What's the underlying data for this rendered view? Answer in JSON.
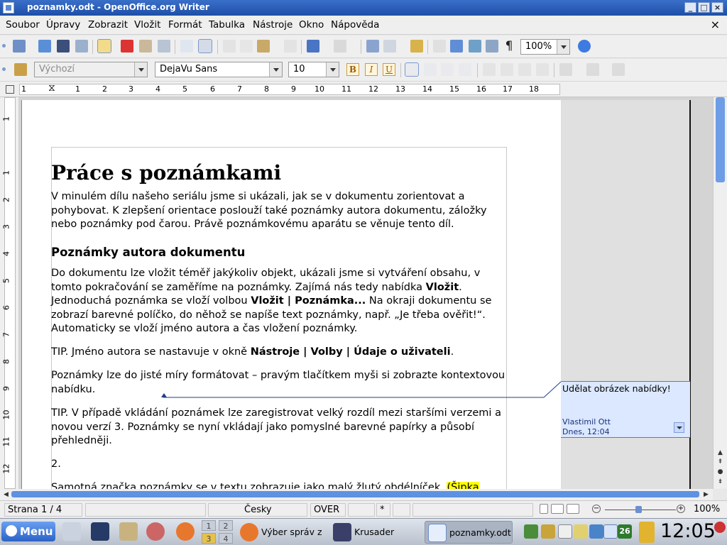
{
  "window": {
    "title": "poznamky.odt - OpenOffice.org Writer",
    "min": "_",
    "max": "□",
    "close": "×"
  },
  "menu": {
    "items": [
      "Soubor",
      "Úpravy",
      "Zobrazit",
      "Vložit",
      "Formát",
      "Tabulka",
      "Nástroje",
      "Okno",
      "Nápověda"
    ],
    "close": "×"
  },
  "toolbar": {
    "zoom": "100%",
    "style": "Výchozí",
    "font": "DejaVu Sans",
    "size": "10",
    "bold": "B",
    "italic": "I",
    "underline": "U"
  },
  "ruler": {
    "numbers": [
      "1",
      "1",
      "2",
      "3",
      "4",
      "5",
      "6",
      "7",
      "8",
      "9",
      "10",
      "11",
      "12",
      "13",
      "14",
      "15",
      "16",
      "17",
      "18"
    ],
    "vnumbers": [
      "1",
      "1",
      "2",
      "3",
      "4",
      "5",
      "6",
      "7",
      "8",
      "9",
      "10",
      "11",
      "12"
    ]
  },
  "document": {
    "heading1": "Práce s poznámkami",
    "p1": "V minulém dílu našeho seriálu jsme si ukázali, jak se v dokumentu zorientovat a pohybovat. K zlepšení orientace poslouží také poznámky autora dokumentu, záložky nebo poznámky pod čarou. Právě poznámkovému aparátu se věnuje tento díl.",
    "heading2": "Poznámky autora dokumentu",
    "p2a": "Do dokumentu lze vložit téměř jakýkoliv objekt, ukázali jsme si vytváření obsahu, v tomto pokračování se zaměříme na poznámky. Zajímá nás tedy nabídka ",
    "p2b": "Vložit",
    "p2c": ". Jednoduchá poznámka se vloží volbou ",
    "p2d": "Vložit | Poznámka...",
    "p2e": " Na okraji dokumentu se zobrazí barevné políčko, do něhož se napíše text poznámky, např. „Je třeba ověřit!“. Automaticky se vloží jméno autora a čas vložení poznámky.",
    "p3a": "TIP. Jméno autora se nastavuje v okně ",
    "p3b": "Nástroje | Volby | Údaje o uživateli",
    "p3c": ".",
    "p4": "Poznámky lze do jisté míry formátovat – pravým tlačítkem myši si zobrazte kontextovou nabídku.",
    "p5": "TIP. V případě vkládání poznámek lze zaregistrovat velký rozdíl mezi staršími verzemi a novou verzí 3. Poznámky se nyní vkládají jako pomyslné barevné papírky a působí přehledněji.",
    "p6": "2.",
    "p7a": "Samotná značka poznámky se v textu zobrazuje jako malý žlutý obdélníček. ",
    "p7b": "(Šipka"
  },
  "comment": {
    "text": "Udělat obrázek nabídky!",
    "author": "Vlastimil Ott",
    "date": "Dnes, 12:04"
  },
  "status": {
    "page": "Strana 1 / 4",
    "lang": "Česky",
    "mode": "OVER",
    "modified": "*",
    "zoom": "100%"
  },
  "taskbar": {
    "menu": "Menu",
    "ws": [
      "1",
      "2",
      "3",
      "4"
    ],
    "tasks": [
      "Výber správ z",
      "Krusader",
      "poznamky.odt"
    ],
    "clock": "12:05",
    "tray_badge": "26"
  },
  "colors": {
    "accent": "#2b63c7",
    "note_bg": "#dbe8ff",
    "highlight": "#ffff00"
  }
}
